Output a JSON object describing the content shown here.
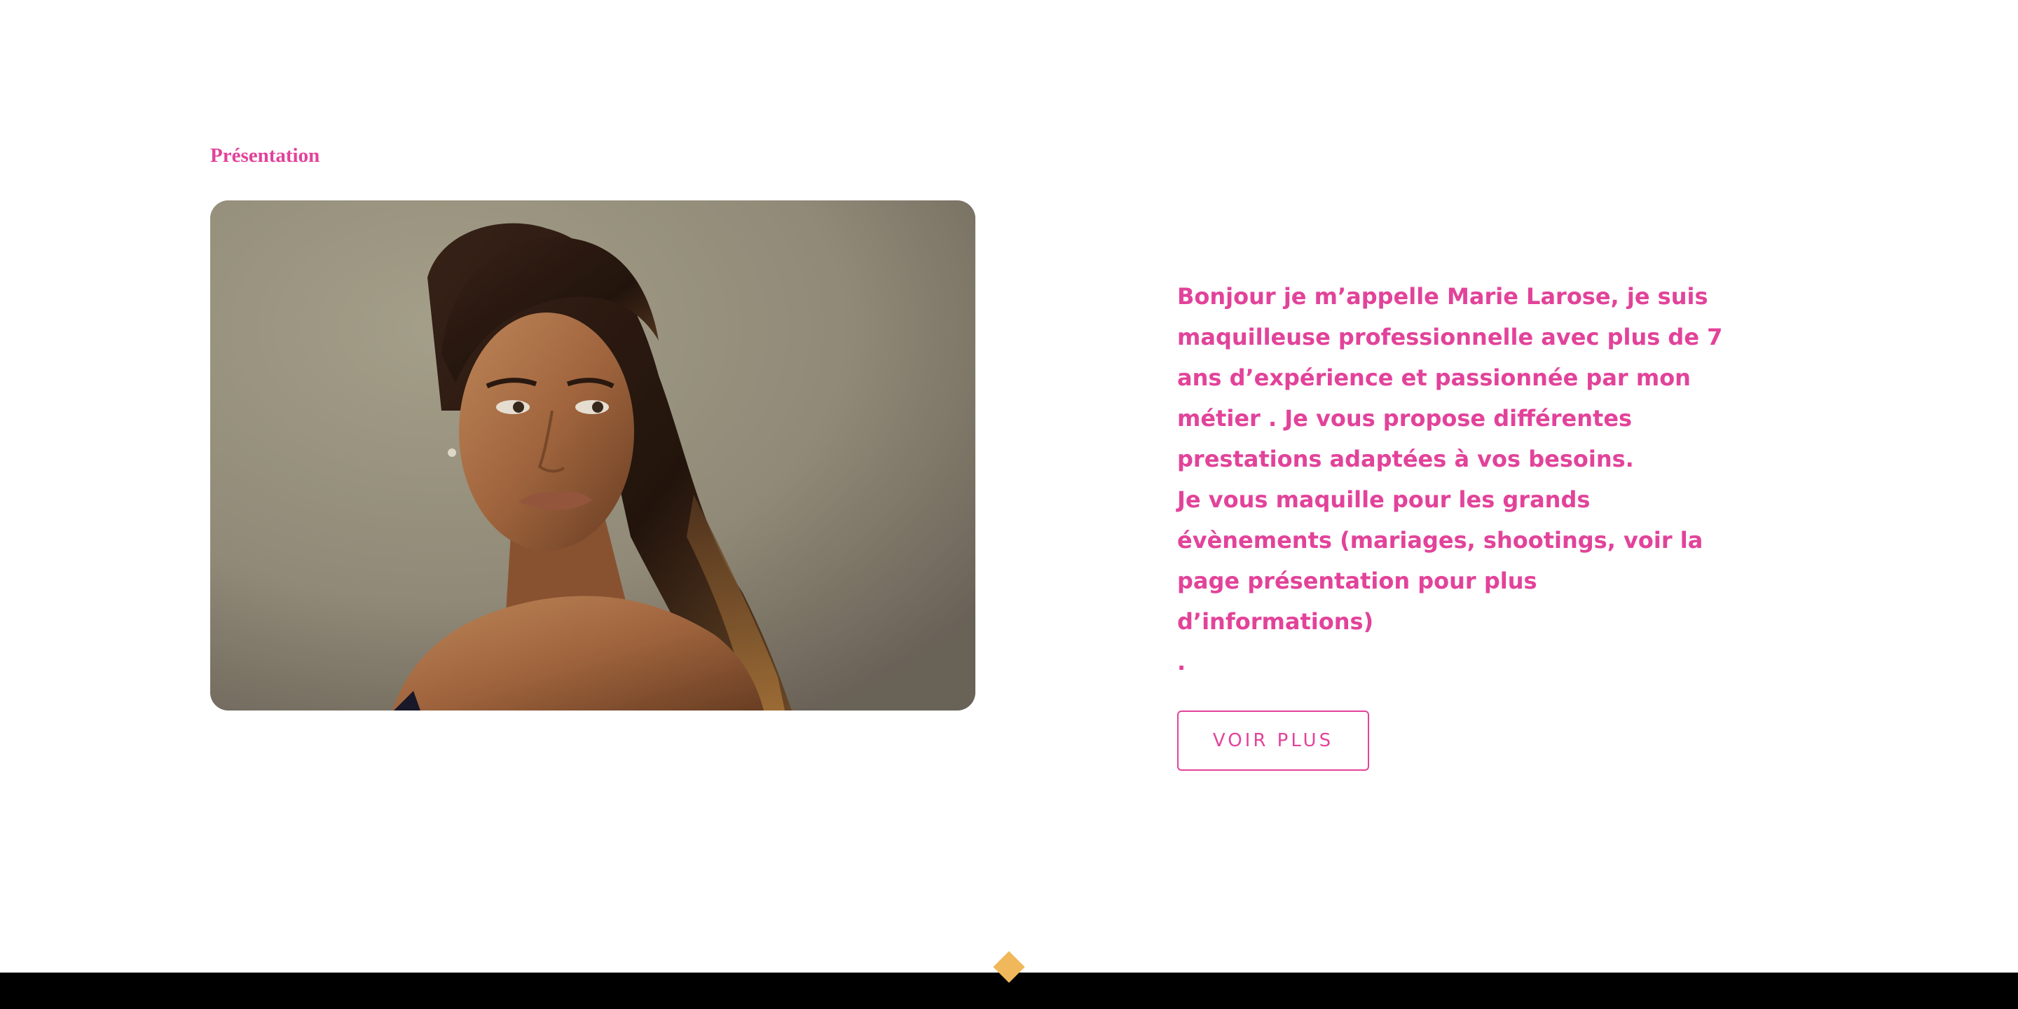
{
  "section": {
    "label": "Présentation"
  },
  "intro": {
    "text": "Bonjour je m’appelle Marie Larose, je suis\nmaquilleuse professionnelle avec plus de 7\nans d’expérience et passionnée par mon\nmétier . Je vous propose différentes\nprestations adaptées à vos besoins.\nJe vous maquille pour les grands\névènements (mariages, shootings, voir la\npage présentation pour plus d’informations)\n."
  },
  "cta": {
    "label": "VOIR PLUS"
  },
  "colors": {
    "accent": "#e2439a",
    "diamond": "#f0b85a",
    "footer": "#000000",
    "background": "#ffffff"
  }
}
